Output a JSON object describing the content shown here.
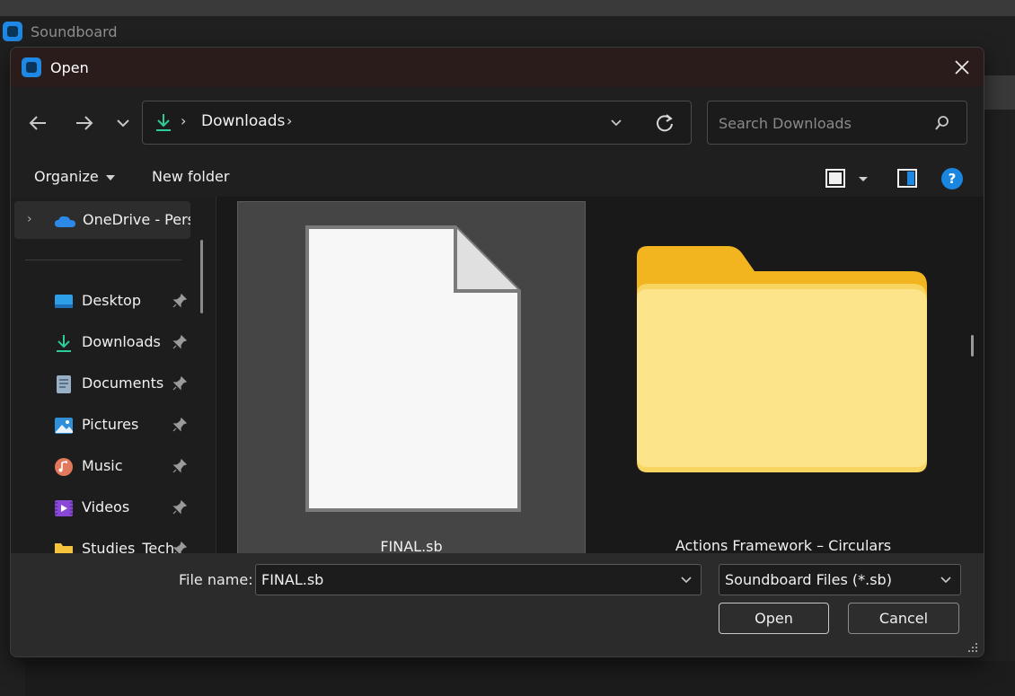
{
  "app": {
    "title": "Soundboard"
  },
  "dialog": {
    "title": "Open",
    "close_icon": "close-icon"
  },
  "nav": {
    "back_icon": "arrow-left-icon",
    "forward_icon": "arrow-right-icon",
    "recent_icon": "chevron-down-icon",
    "breadcrumb": {
      "location": "Downloads",
      "icon": "download-icon"
    },
    "refresh_icon": "refresh-icon",
    "search_placeholder": "Search Downloads"
  },
  "toolbar": {
    "organize": "Organize",
    "new_folder": "New folder",
    "help": "?"
  },
  "sidebar": {
    "onedrive": "OneDrive - Perso",
    "items": [
      {
        "label": "Desktop",
        "icon": "desktop-icon"
      },
      {
        "label": "Downloads",
        "icon": "download-icon"
      },
      {
        "label": "Documents",
        "icon": "document-icon"
      },
      {
        "label": "Pictures",
        "icon": "pictures-icon"
      },
      {
        "label": "Music",
        "icon": "music-icon"
      },
      {
        "label": "Videos",
        "icon": "videos-icon"
      },
      {
        "label": "Studies_Tech",
        "icon": "folder-icon"
      }
    ]
  },
  "files": [
    {
      "name": "FINAL.sb",
      "type": "file",
      "selected": true
    },
    {
      "name": "Actions Framework – Circulars",
      "type": "folder",
      "selected": false
    }
  ],
  "footer": {
    "file_name_label": "File name:",
    "file_name_value": "FINAL.sb",
    "file_type": "Soundboard Files (*.sb)",
    "open": "Open",
    "cancel": "Cancel"
  },
  "colors": {
    "accent": "#1e88e5",
    "download_green": "#2ecc9a",
    "folder_yellow": "#f5c43a"
  }
}
